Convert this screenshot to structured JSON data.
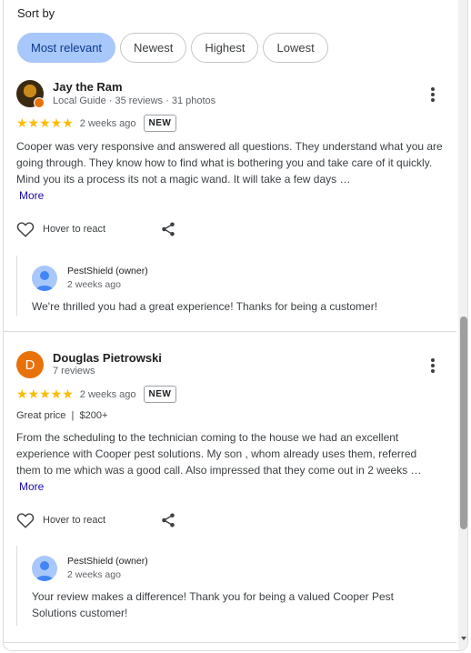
{
  "sort": {
    "label": "Sort by",
    "options": [
      "Most relevant",
      "Newest",
      "Highest",
      "Lowest"
    ],
    "selected": "Most relevant"
  },
  "reviews": [
    {
      "name": "Jay the Ram",
      "meta": "Local Guide · 35 reviews · 31 photos",
      "rating": 5,
      "stars": "★★★★★",
      "when": "2 weeks ago",
      "badge": "NEW",
      "text": "Cooper was very responsive and answered all questions. They understand what you are going through. They know how to find what is bothering you and take care of it quickly. Mind you its a process its not a magic wand. It will take a few days …",
      "more": "More",
      "react_label": "Hover to react",
      "owner_reply": {
        "name": "PestShield (owner)",
        "when": "2 weeks ago",
        "text": "We're thrilled you had a great experience! Thanks for being a customer!"
      }
    },
    {
      "initial": "D",
      "name": "Douglas Pietrowski",
      "meta": "7 reviews",
      "rating": 5,
      "stars": "★★★★★",
      "when": "2 weeks ago",
      "badge": "NEW",
      "attrs": "Great price  |  $200+",
      "text": "From the scheduling to the technician coming to the house we had an excellent experience with Cooper pest solutions. My son , whom already uses them, referred them to me which was a good call. Also impressed that they come out in 2 weeks …",
      "more": "More",
      "react_label": "Hover to react",
      "owner_reply": {
        "name": "PestShield (owner)",
        "when": "2 weeks ago",
        "text": "Your review makes a difference! Thank you for being a valued Cooper Pest Solutions customer!"
      }
    }
  ],
  "colors": {
    "accent_chip": "#a8c7fa",
    "star": "#fbbc04",
    "avatar_orange": "#e8710a",
    "link": "#1a0dab"
  },
  "icons": [
    "more-vert-icon",
    "heart-icon",
    "share-icon",
    "person-icon"
  ]
}
